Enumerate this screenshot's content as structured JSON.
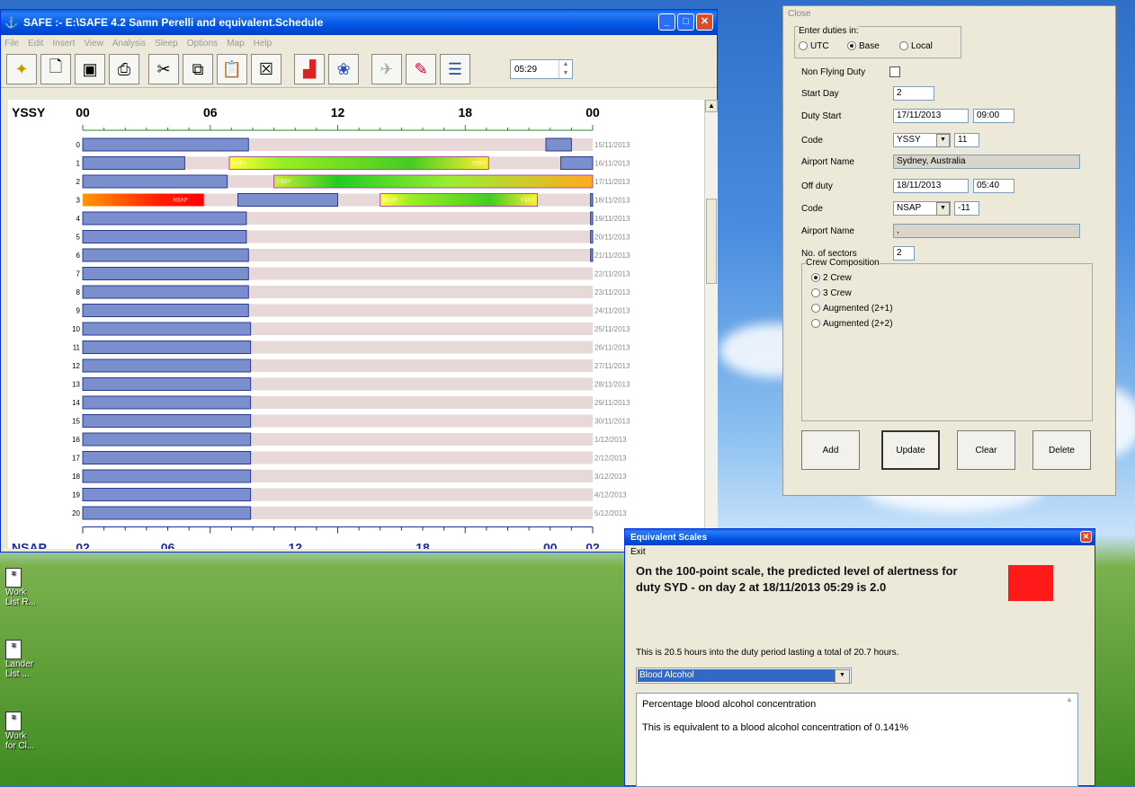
{
  "main_window": {
    "title": "SAFE :- E:\\SAFE 4.2 Samn Perelli and equivalent.Schedule",
    "menu": [
      "File",
      "Edit",
      "Insert",
      "View",
      "Analysis",
      "Sleep",
      "Options",
      "Map",
      "Help"
    ],
    "time_value": "05:29",
    "icons": [
      "open-icon",
      "new-icon",
      "save-icon",
      "print-icon",
      "cut-icon",
      "copy-icon",
      "paste-icon",
      "delete-icon",
      "chart-icon",
      "brain-icon",
      "plane-icon",
      "wand-icon",
      "layers-icon"
    ]
  },
  "chart_data": {
    "type": "gantt",
    "top_airport": "YSSY",
    "bottom_airport": "NSAP",
    "top_ticks": [
      "00",
      "06",
      "12",
      "18",
      "00"
    ],
    "bottom_ticks": [
      "02",
      "06",
      "12",
      "18",
      "00",
      "02"
    ],
    "rows": [
      {
        "n": "0",
        "date": "15/11/2013",
        "sleep": [
          [
            0,
            7.8
          ],
          [
            21.8,
            23
          ]
        ]
      },
      {
        "n": "1",
        "date": "16/11/2013",
        "sleep": [
          [
            0,
            4.8
          ],
          [
            22.5,
            24
          ]
        ],
        "duty": {
          "start": 6.9,
          "end": 19.1,
          "from": "YSSY",
          "to": "YSSY",
          "style": "green"
        }
      },
      {
        "n": "2",
        "date": "17/11/2013",
        "sleep": [
          [
            0,
            6.8
          ]
        ],
        "duty": {
          "start": 9,
          "end": 24,
          "from": "YSSY",
          "style": "greenyellow"
        }
      },
      {
        "n": "3",
        "date": "18/11/2013",
        "duty_prev": {
          "start": 0,
          "end": 5.7,
          "to": "NSAP"
        },
        "sleep": [
          [
            7.3,
            12
          ],
          [
            23.9,
            24
          ]
        ],
        "duty": {
          "start": 14,
          "end": 21.4,
          "from": "NSAP",
          "to": "YSSY",
          "style": "green"
        }
      },
      {
        "n": "4",
        "date": "19/11/2013",
        "sleep": [
          [
            0,
            7.7
          ],
          [
            23.9,
            24
          ]
        ]
      },
      {
        "n": "5",
        "date": "20/11/2013",
        "sleep": [
          [
            0,
            7.7
          ],
          [
            23.9,
            24
          ]
        ]
      },
      {
        "n": "6",
        "date": "21/11/2013",
        "sleep": [
          [
            0,
            7.8
          ],
          [
            23.9,
            24
          ]
        ]
      },
      {
        "n": "7",
        "date": "22/11/2013",
        "sleep": [
          [
            0,
            7.8
          ]
        ]
      },
      {
        "n": "8",
        "date": "23/11/2013",
        "sleep": [
          [
            0,
            7.8
          ]
        ]
      },
      {
        "n": "9",
        "date": "24/11/2013",
        "sleep": [
          [
            0,
            7.8
          ]
        ]
      },
      {
        "n": "10",
        "date": "25/11/2013",
        "sleep": [
          [
            0,
            7.9
          ]
        ]
      },
      {
        "n": "11",
        "date": "26/11/2013",
        "sleep": [
          [
            0,
            7.9
          ]
        ]
      },
      {
        "n": "12",
        "date": "27/11/2013",
        "sleep": [
          [
            0,
            7.9
          ]
        ]
      },
      {
        "n": "13",
        "date": "28/11/2013",
        "sleep": [
          [
            0,
            7.9
          ]
        ]
      },
      {
        "n": "14",
        "date": "29/11/2013",
        "sleep": [
          [
            0,
            7.9
          ]
        ]
      },
      {
        "n": "15",
        "date": "30/11/2013",
        "sleep": [
          [
            0,
            7.9
          ]
        ]
      },
      {
        "n": "16",
        "date": "1/12/2013",
        "sleep": [
          [
            0,
            7.9
          ]
        ]
      },
      {
        "n": "17",
        "date": "2/12/2013",
        "sleep": [
          [
            0,
            7.9
          ]
        ]
      },
      {
        "n": "18",
        "date": "3/12/2013",
        "sleep": [
          [
            0,
            7.9
          ]
        ]
      },
      {
        "n": "19",
        "date": "4/12/2013",
        "sleep": [
          [
            0,
            7.9
          ]
        ]
      },
      {
        "n": "20",
        "date": "5/12/2013",
        "sleep": [
          [
            0,
            7.9
          ]
        ]
      }
    ]
  },
  "duty_panel": {
    "close_label": "Close",
    "enter_duties_label": "Enter duties in:",
    "tz_options": [
      "UTC",
      "Base",
      "Local"
    ],
    "tz_selected": "Base",
    "non_flying_label": "Non Flying Duty",
    "start_day_label": "Start Day",
    "start_day": "2",
    "duty_start_label": "Duty Start",
    "duty_start_date": "17/11/2013",
    "duty_start_time": "09:00",
    "code_label": "Code",
    "start_code": "YSSY",
    "start_offset": "11",
    "airport_name_label": "Airport Name",
    "start_airport_name": "Sydney, Australia",
    "off_duty_label": "Off duty",
    "off_duty_date": "18/11/2013",
    "off_duty_time": "05:40",
    "end_code": "NSAP",
    "end_offset": "-11",
    "end_airport_name": ",",
    "sectors_label": "No. of sectors",
    "sectors": "2",
    "crew_label": "Crew Composition",
    "crew_options": [
      "2 Crew",
      "3 Crew",
      "Augmented (2+1)",
      "Augmented (2+2)"
    ],
    "buttons": {
      "add": "Add",
      "update": "Update",
      "clear": "Clear",
      "delete": "Delete"
    }
  },
  "equiv_window": {
    "title": "Equivalent Scales",
    "menu_exit": "Exit",
    "headline": "On the 100-point scale, the predicted level of alertness for duty SYD -  on day 2 at 18/11/2013 05:29 is 2.0",
    "indicator_color": "#ff1a1a",
    "duty_info": "This is 20.5 hours into the duty period lasting a total of 20.7 hours.",
    "scale_selected": "Blood Alcohol",
    "text_line1": "Percentage blood alcohol concentration",
    "text_line2": "This is equivalent to a blood alcohol concentration of 0.141%"
  },
  "desktop_icons": [
    {
      "label": "Work\nList R..."
    },
    {
      "label": "Lander\nList ..."
    },
    {
      "label": "Work\nfor Cl..."
    }
  ]
}
